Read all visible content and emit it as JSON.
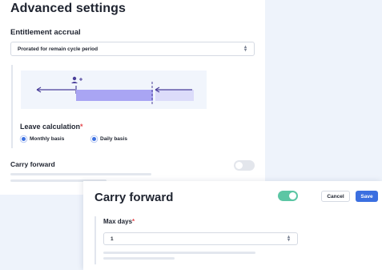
{
  "advanced": {
    "title": "Advanced settings",
    "accrual_label": "Entitlement accrual",
    "accrual_value": "Prorated for remain cycle period",
    "leave_label": "Leave calculation",
    "required_mark": "*",
    "leave_options": [
      {
        "label": "Monthly basis",
        "selected": true
      },
      {
        "label": "Daily basis",
        "selected": true
      }
    ],
    "carry_label": "Carry forward",
    "carry_toggle_on": false
  },
  "carry_forward": {
    "title": "Carry forward",
    "toggle_on": true,
    "cancel_label": "Cancel",
    "save_label": "Save",
    "max_days_label": "Max days",
    "required_mark": "*",
    "max_days_value": "1"
  },
  "colors": {
    "accent": "#3b6fe0",
    "toggle_on": "#5cc6a4",
    "required": "#e5484d",
    "diagram_bar": "#a9a5f3",
    "diagram_arrow": "#4a3f9a"
  }
}
